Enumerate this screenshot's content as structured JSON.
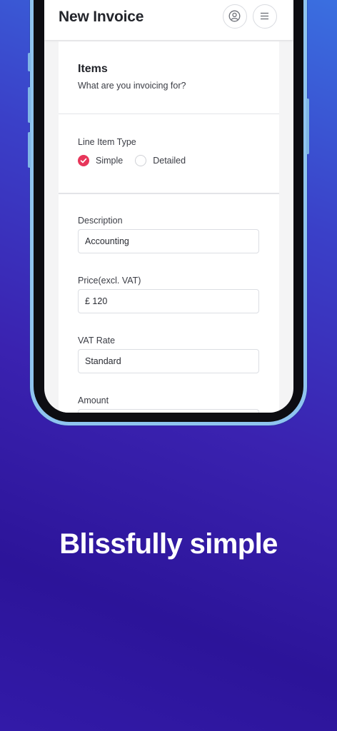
{
  "header": {
    "title": "New Invoice",
    "account_icon": "user-circle-icon",
    "menu_icon": "hamburger-menu-icon"
  },
  "items_section": {
    "title": "Items",
    "subtitle": "What are you invoicing for?"
  },
  "line_item_type": {
    "label": "Line Item Type",
    "options": [
      {
        "label": "Simple",
        "selected": true
      },
      {
        "label": "Detailed",
        "selected": false
      }
    ]
  },
  "fields": {
    "description": {
      "label": "Description",
      "value": "Accounting"
    },
    "price": {
      "label": "Price(excl. VAT)",
      "value": "£ 120"
    },
    "vat_rate": {
      "label": "VAT Rate",
      "value": "Standard"
    },
    "amount": {
      "label": "Amount",
      "value": ""
    }
  },
  "tagline": "Blissfully simple",
  "colors": {
    "accent": "#e7365a",
    "background_top": "#3a6fe0",
    "background_bottom": "#2c1499",
    "phone_frame": "#8fc4ef"
  }
}
